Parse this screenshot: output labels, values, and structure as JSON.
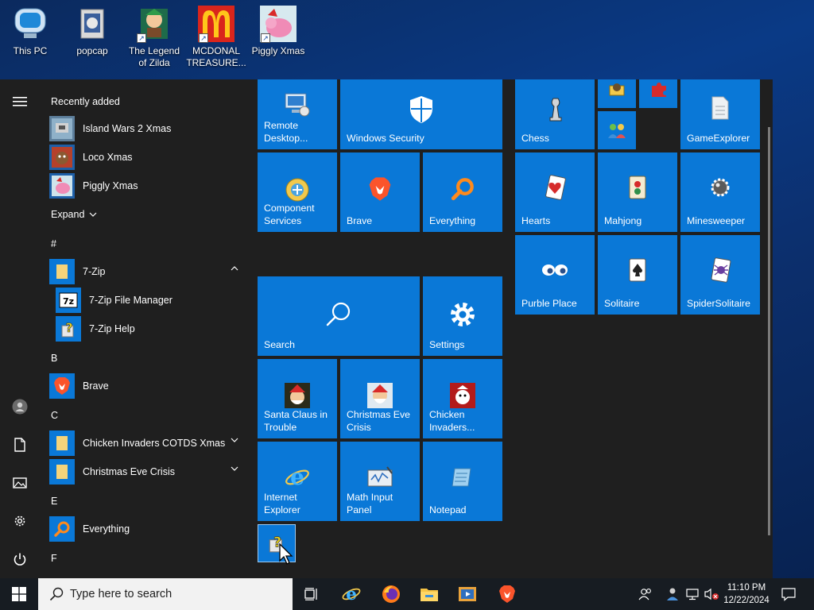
{
  "desktop": {
    "icons": [
      {
        "label": "This PC",
        "icon": "this-pc-icon",
        "shortcut": false
      },
      {
        "label": "popcap",
        "icon": "folder-icon",
        "shortcut": false
      },
      {
        "label": "The Legend\nof Zilda",
        "icon": "game-icon",
        "shortcut": true
      },
      {
        "label": "MCDONAL\nTREASURE...",
        "icon": "mcdonalds-icon",
        "shortcut": true
      },
      {
        "label": "Piggly Xmas",
        "icon": "piggly-icon",
        "shortcut": true
      }
    ]
  },
  "start_menu": {
    "recently_added_title": "Recently added",
    "expand_label": "Expand",
    "sections": {
      "hash": "#",
      "b": "B",
      "c": "C",
      "e": "E",
      "f": "F"
    },
    "apps": {
      "island_wars": "Island Wars 2 Xmas",
      "loco_xmas": "Loco Xmas",
      "piggly_xmas": "Piggly Xmas",
      "zip7": "7-Zip",
      "zip7_fm": "7-Zip File Manager",
      "zip7_help": "7-Zip Help",
      "brave": "Brave",
      "chicken_invaders": "Chicken Invaders COTDS Xmas",
      "christmas_eve": "Christmas Eve Crisis",
      "everything": "Everything"
    },
    "tiles": {
      "remote_desktop": "Remote\nDesktop...",
      "windows_security": "Windows Security",
      "component_services": "Component\nServices",
      "brave": "Brave",
      "everything": "Everything",
      "search": "Search",
      "settings": "Settings",
      "santa": "Santa Claus in\nTrouble",
      "christmas_eve": "Christmas Eve\nCrisis",
      "chicken": "Chicken\nInvaders...",
      "ie": "Internet\nExplorer",
      "math": "Math Input\nPanel",
      "notepad": "Notepad",
      "chess": "Chess",
      "game_explorer": "GameExplorer",
      "hearts": "Hearts",
      "mahjong": "Mahjong",
      "minesweeper": "Minesweeper",
      "purble": "Purble Place",
      "solitaire": "Solitaire",
      "spider": "SpiderSolitaire"
    }
  },
  "taskbar": {
    "search_placeholder": "Type here to search",
    "time": "11:10 PM",
    "date": "12/22/2024"
  },
  "colors": {
    "tile": "#0a78d7",
    "menu_bg": "#1f1f1f",
    "taskbar_bg": "#171c22"
  }
}
